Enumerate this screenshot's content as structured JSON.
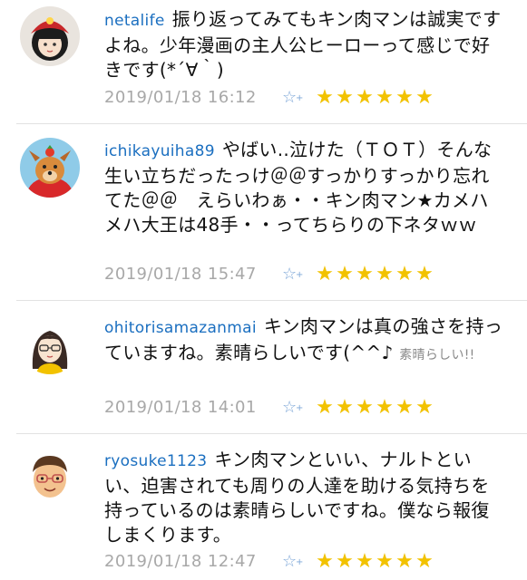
{
  "comments": [
    {
      "username": "netalife",
      "body": "振り返ってみてもキン肉マンは誠実ですよね。少年漫画の主人公ヒーローって感じで好きです(*´∀｀)",
      "tail": "",
      "date": "2019/01/18 16:12",
      "rating": 6,
      "avatar": "girl-red-hat-avatar"
    },
    {
      "username": "ichikayuiha89",
      "body": "やばい..泣けた（ＴＯＴ）そんな生い立ちだったっけ＠＠すっかりすっかり忘れてた＠＠　えらいわぁ・・キン肉マン★カメハメハ大王は48手・・ってちらりの下ネタｗｗ",
      "tail": "",
      "date": "2019/01/18 15:47",
      "rating": 6,
      "avatar": "dog-avatar"
    },
    {
      "username": "ohitorisamazanmai",
      "body": "キン肉マンは真の強さを持っていますね。素晴らしいです(^^♪ ",
      "tail": "素晴らしい!!",
      "date": "2019/01/18 14:01",
      "rating": 6,
      "avatar": "glasses-girl-avatar"
    },
    {
      "username": "ryosuke1123",
      "body": "キン肉マンといい、ナルトといい、迫害されても周りの人達を助ける気持ちを持っているのは素晴らしいですね。僕なら報復しまくります。",
      "tail": "",
      "date": "2019/01/18 12:47",
      "rating": 6,
      "avatar": "glasses-boy-avatar"
    }
  ],
  "icons": {
    "favorite": "☆",
    "favorite_plus": "+",
    "star": "★"
  },
  "colors": {
    "username": "#1b6fc0",
    "star": "#f2c200",
    "date": "#a8a8a8"
  }
}
